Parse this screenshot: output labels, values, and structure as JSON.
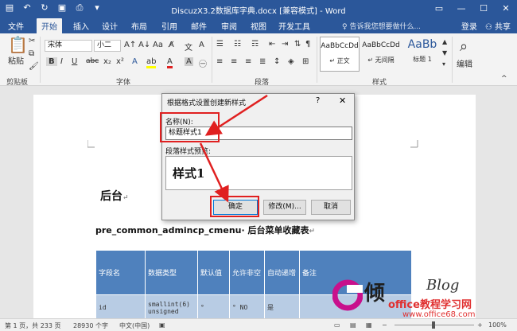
{
  "window": {
    "title": "DiscuzX3.2数据库字典.docx [兼容模式] - Word",
    "qat_icons": [
      "save-icon",
      "undo-icon",
      "redo-icon",
      "document-icon",
      "print-icon",
      "customize-icon"
    ],
    "controls": [
      "ribbon-display-icon",
      "minimize-icon",
      "maximize-icon",
      "close-icon"
    ]
  },
  "tabs": {
    "items": [
      "文件",
      "开始",
      "插入",
      "设计",
      "布局",
      "引用",
      "邮件",
      "审阅",
      "视图",
      "开发工具"
    ],
    "active": "开始",
    "tellme": "告诉我您想要做什么...",
    "login": "登录",
    "share": "共享"
  },
  "ribbon": {
    "clipboard": {
      "paste": "粘贴",
      "label": "剪贴板"
    },
    "font": {
      "name": "宋体",
      "size": "小二",
      "label": "字体",
      "bold": "B",
      "italic": "I",
      "underline": "U",
      "strike": "abc",
      "sub": "x₂",
      "sup": "x²"
    },
    "paragraph": {
      "label": "段落"
    },
    "styles": {
      "items": [
        {
          "sample": "AaBbCcDd",
          "name": "↵ 正文"
        },
        {
          "sample": "AaBbCcDd",
          "name": "↵ 无间隔"
        },
        {
          "sample": "AaBb",
          "name": "标题 1"
        }
      ],
      "label": "样式"
    },
    "editing": {
      "label": "编辑"
    }
  },
  "document": {
    "heading": "后台",
    "subheading": "pre_common_admincp_cmenu· 后台菜单收藏表",
    "table": {
      "headers": [
        "字段名",
        "数据类型",
        "默认值",
        "允许非空",
        "自动递增",
        "备注"
      ],
      "rows": [
        [
          "id",
          "smallint(6) unsigned",
          "°",
          "° NO",
          "是",
          ""
        ]
      ]
    }
  },
  "dialog": {
    "title": "根据格式设置创建新样式",
    "help": "?",
    "close": "✕",
    "name_label": "名称(N):",
    "name_value": "标题样式1",
    "preview_label": "段落样式预览:",
    "preview_text": "样式1",
    "ok": "确定",
    "modify": "修改(M)...",
    "cancel": "取消"
  },
  "watermark": {
    "big": "倾",
    "blog": "Blog",
    "cn": "office教程学习网",
    "url": "www.office68.com"
  },
  "status": {
    "page": "第 1 页，共 233 页",
    "words": "28930 个字",
    "lang": "中文(中国)",
    "zoom": "100%"
  },
  "colors": {
    "accent": "#2b579a",
    "highlight": "#e02020",
    "table_header": "#4f81bd",
    "table_row": "#b8cce4"
  }
}
